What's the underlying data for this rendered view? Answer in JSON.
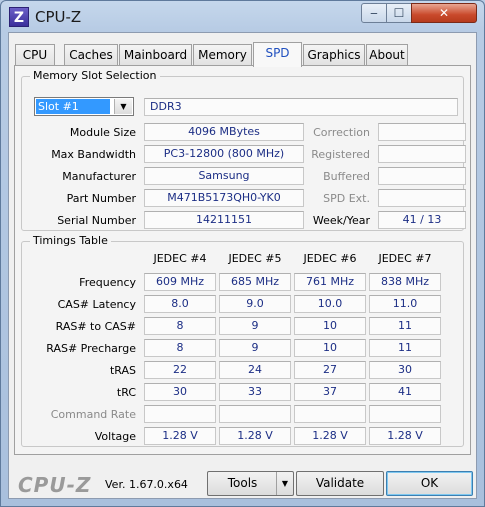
{
  "window": {
    "title": "CPU-Z",
    "icon_letter": "Z"
  },
  "tabs": [
    "CPU",
    "Caches",
    "Mainboard",
    "Memory",
    "SPD",
    "Graphics",
    "About"
  ],
  "active_tab": "SPD",
  "slot_selection": {
    "legend": "Memory Slot Selection",
    "selected_slot": "Slot #1",
    "memory_type": "DDR3"
  },
  "module_fields": [
    {
      "label": "Module Size",
      "value": "4096 MBytes"
    },
    {
      "label": "Max Bandwidth",
      "value": "PC3-12800 (800 MHz)"
    },
    {
      "label": "Manufacturer",
      "value": "Samsung"
    },
    {
      "label": "Part Number",
      "value": "M471B5173QH0-YK0"
    },
    {
      "label": "Serial Number",
      "value": "14211151"
    }
  ],
  "right_fields": [
    {
      "label": "Correction",
      "value": "",
      "enabled": false
    },
    {
      "label": "Registered",
      "value": "",
      "enabled": false
    },
    {
      "label": "Buffered",
      "value": "",
      "enabled": false
    },
    {
      "label": "SPD Ext.",
      "value": "",
      "enabled": false
    },
    {
      "label": "Week/Year",
      "value": "41 / 13",
      "enabled": true
    }
  ],
  "timings": {
    "legend": "Timings Table",
    "columns": [
      "JEDEC #4",
      "JEDEC #5",
      "JEDEC #6",
      "JEDEC #7"
    ],
    "rows": [
      {
        "label": "Frequency",
        "values": [
          "609 MHz",
          "685 MHz",
          "761 MHz",
          "838 MHz"
        ]
      },
      {
        "label": "CAS# Latency",
        "values": [
          "8.0",
          "9.0",
          "10.0",
          "11.0"
        ]
      },
      {
        "label": "RAS# to CAS#",
        "values": [
          "8",
          "9",
          "10",
          "11"
        ]
      },
      {
        "label": "RAS# Precharge",
        "values": [
          "8",
          "9",
          "10",
          "11"
        ]
      },
      {
        "label": "tRAS",
        "values": [
          "22",
          "24",
          "27",
          "30"
        ]
      },
      {
        "label": "tRC",
        "values": [
          "30",
          "33",
          "37",
          "41"
        ]
      },
      {
        "label": "Command Rate",
        "values": [
          "",
          "",
          "",
          ""
        ],
        "disabled": true
      },
      {
        "label": "Voltage",
        "values": [
          "1.28 V",
          "1.28 V",
          "1.28 V",
          "1.28 V"
        ]
      }
    ]
  },
  "footer": {
    "logo": "CPU-Z",
    "version": "Ver. 1.67.0.x64",
    "tools_label": "Tools",
    "validate_label": "Validate",
    "ok_label": "OK"
  },
  "window_controls": {
    "minimize": "‒",
    "maximize": "☐",
    "close": "✕"
  }
}
